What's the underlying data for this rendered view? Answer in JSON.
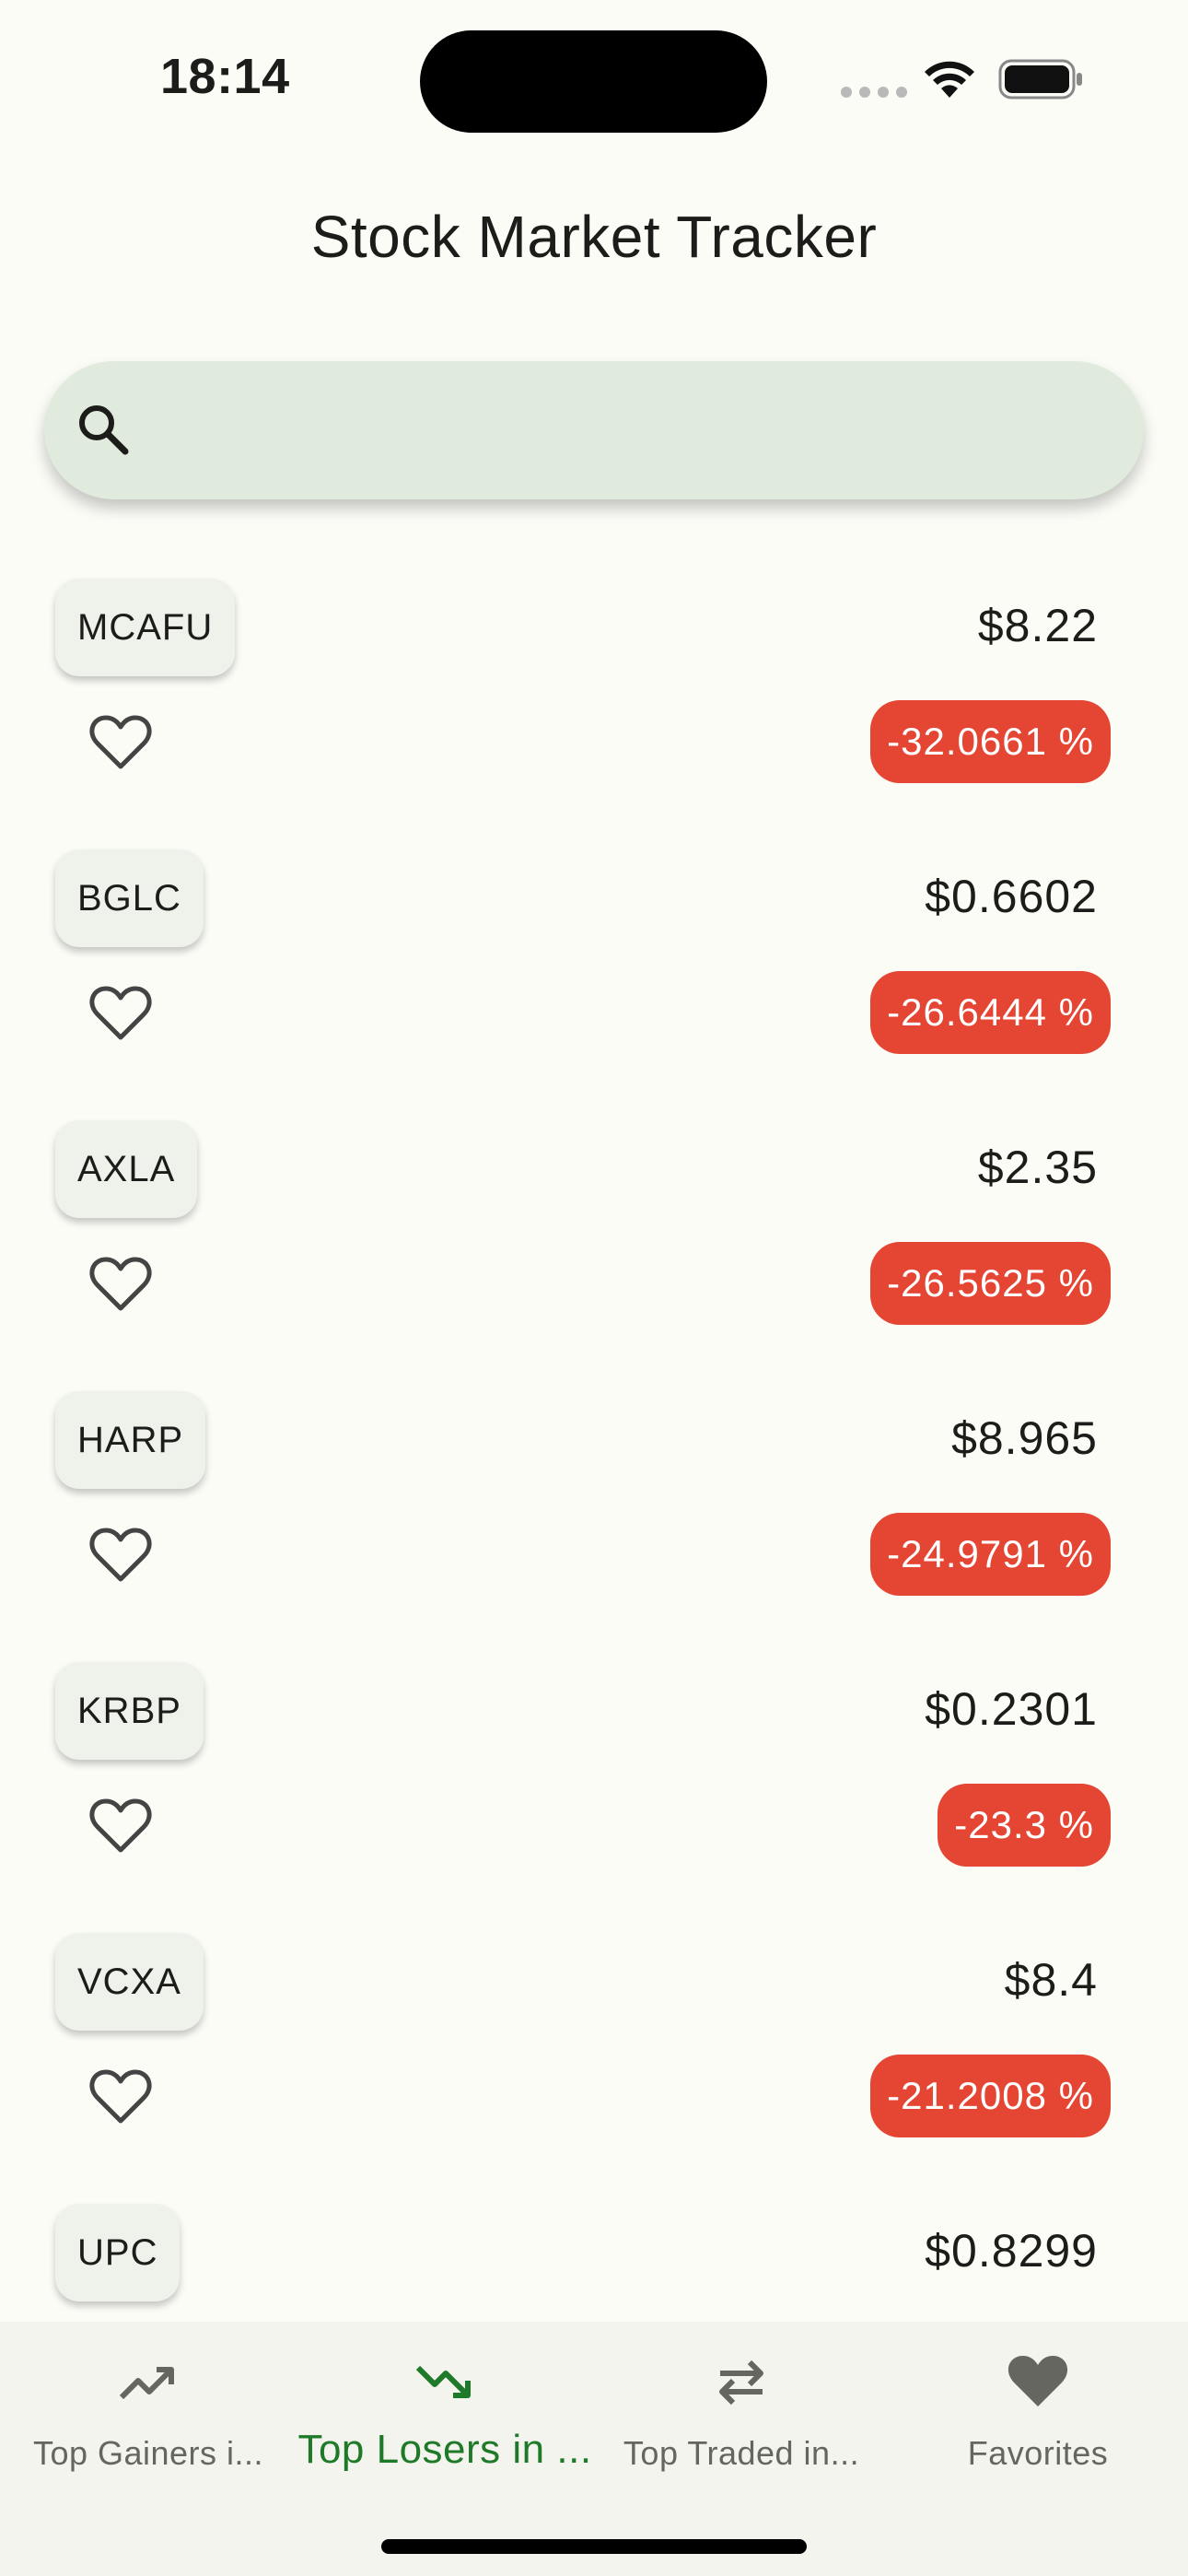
{
  "status_bar": {
    "time": "18:14"
  },
  "app": {
    "title": "Stock Market Tracker"
  },
  "search": {
    "placeholder": "",
    "value": ""
  },
  "colors": {
    "loss_badge": "#e54533",
    "active_tab": "#1e7a28",
    "search_bg": "#e0eadd"
  },
  "stocks": [
    {
      "symbol": "MCAFU",
      "price": "$8.22",
      "change": "-32.0661 %"
    },
    {
      "symbol": "BGLC",
      "price": "$0.6602",
      "change": "-26.6444 %"
    },
    {
      "symbol": "AXLA",
      "price": "$2.35",
      "change": "-26.5625 %"
    },
    {
      "symbol": "HARP",
      "price": "$8.965",
      "change": "-24.9791 %"
    },
    {
      "symbol": "KRBP",
      "price": "$0.2301",
      "change": "-23.3 %"
    },
    {
      "symbol": "VCXA",
      "price": "$8.4",
      "change": "-21.2008 %"
    },
    {
      "symbol": "UPC",
      "price": "$0.8299",
      "change": ""
    }
  ],
  "nav": {
    "items": [
      {
        "label": "Top Gainers i...",
        "icon": "trending-up-icon",
        "active": false
      },
      {
        "label": "Top Losers in ...",
        "icon": "trending-down-icon",
        "active": true
      },
      {
        "label": "Top Traded in...",
        "icon": "swap-arrows-icon",
        "active": false
      },
      {
        "label": "Favorites",
        "icon": "heart-icon",
        "active": false
      }
    ]
  }
}
